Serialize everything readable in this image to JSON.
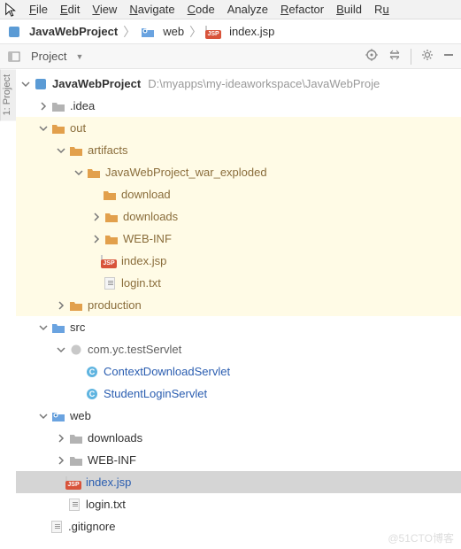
{
  "menu": {
    "file": "File",
    "edit": "Edit",
    "view": "View",
    "navigate": "Navigate",
    "code": "Code",
    "analyze": "Analyze",
    "refactor": "Refactor",
    "build": "Build",
    "run": "R"
  },
  "breadcrumb": {
    "project": "JavaWebProject",
    "web": "web",
    "file": "index.jsp"
  },
  "sidetab": "1: Project",
  "toolHeader": {
    "title": "Project"
  },
  "tree": {
    "root": {
      "name": "JavaWebProject",
      "path": "D:\\myapps\\my-ideaworkspace\\JavaWebProje"
    },
    "idea": ".idea",
    "out": "out",
    "artifacts": "artifacts",
    "warExploded": "JavaWebProject_war_exploded",
    "download": "download",
    "downloads": "downloads",
    "webinf": "WEB-INF",
    "indexjsp": "index.jsp",
    "logintxt": "login.txt",
    "production": "production",
    "src": "src",
    "pkg": "com.yc.testServlet",
    "clsDownload": "ContextDownloadServlet",
    "clsLogin": "StudentLoginServlet",
    "web": "web",
    "downloads2": "downloads",
    "webinf2": "WEB-INF",
    "indexjsp2": "index.jsp",
    "logintxt2": "login.txt",
    "gitignore": ".gitignore"
  },
  "watermark": "@51CTO博客"
}
